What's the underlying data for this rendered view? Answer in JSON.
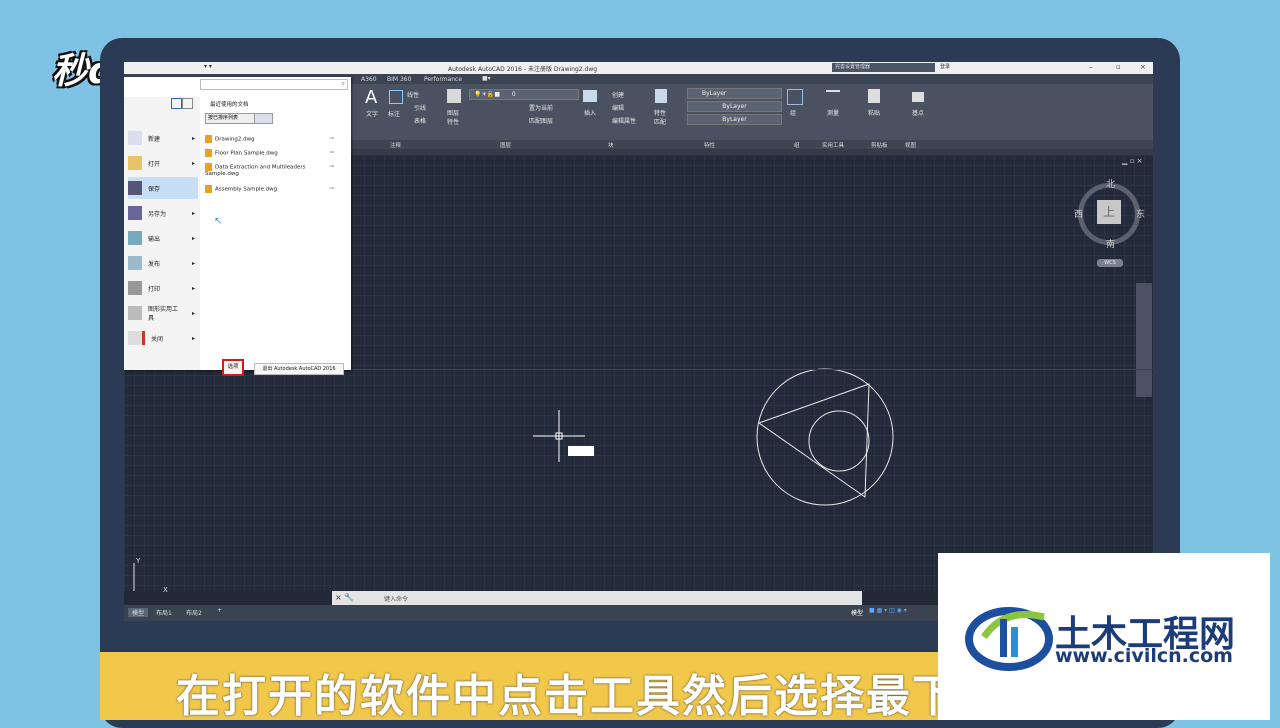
{
  "watermark": "秒dong视频",
  "caption": "在打开的软件中点击工具然后选择最下方",
  "logo": {
    "name": "土木工程网",
    "url": "www.civilcn.com"
  },
  "titlebar": {
    "title": "Autodesk AutoCAD 2016 - 未注册版    Drawing2.dwg",
    "search_placeholder": "完善设置管理器",
    "login": "登录"
  },
  "ribbon_tabs": [
    "A360",
    "BIM 360",
    "Performance"
  ],
  "ribbon": {
    "text_label": "文字",
    "mark_label": "标注",
    "linear": "线性",
    "leader": "引线",
    "table": "表格",
    "layer_prop": "图层特性",
    "layer_value": "0",
    "set_current": "置为当前",
    "match_layer": "匹配图层",
    "insert": "插入",
    "create": "创建",
    "edit": "编辑",
    "edit_attr": "编辑属性",
    "match_prop": "特性匹配",
    "bylayer1": "ByLayer",
    "bylayer2": "ByLayer",
    "bylayer3": "ByLayer",
    "group": "组",
    "measure": "测量",
    "paste": "粘贴",
    "base": "基点"
  },
  "panel_labels": [
    "注释",
    "图层",
    "块",
    "特性",
    "组",
    "实用工具",
    "剪贴板",
    "视图"
  ],
  "app_menu": {
    "recent_title": "最近使用的文档",
    "sort_label": "按已排序列表",
    "items": [
      "新建",
      "打开",
      "保存",
      "另存为",
      "输出",
      "发布",
      "打印",
      "图形实用工具",
      "关闭"
    ],
    "recent": [
      "Drawing2.dwg",
      "Floor Plan Sample.dwg",
      "Data Extraction and Multileaders Sample.dwg",
      "Assembly Sample.dwg"
    ],
    "options": "选项",
    "exit": "退出 Autodesk AutoCAD 2016"
  },
  "viewcube": {
    "north": "北",
    "south": "南",
    "east": "东",
    "west": "西",
    "top": "上",
    "wcs": "WCS"
  },
  "ucs": {
    "y": "Y",
    "x": "X"
  },
  "command_placeholder": "键入命令",
  "layout_tabs": [
    "模型",
    "布局1",
    "布局2",
    "+"
  ],
  "status": {
    "model": "模型"
  }
}
